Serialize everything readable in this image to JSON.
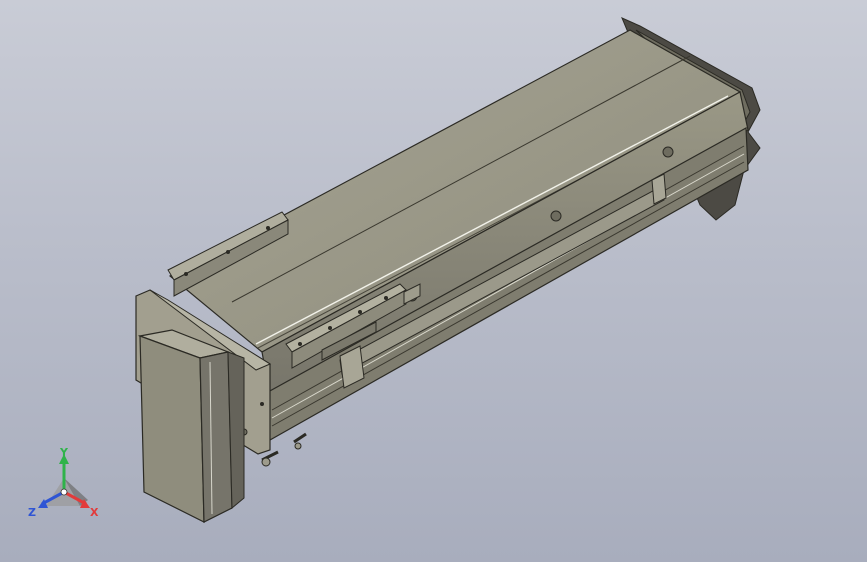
{
  "viewport": {
    "background_top": "#c9ccd6",
    "background_bottom": "#a8adbd"
  },
  "model": {
    "body_color": "#8e8c7a",
    "face_light": "#a3a190",
    "face_dark": "#6f6d5f",
    "edge_color": "#2b2a24"
  },
  "triad": {
    "x_label": "X",
    "y_label": "Y",
    "z_label": "Z",
    "x_color": "#e23b3b",
    "y_color": "#2fb34a",
    "z_color": "#2f55d4"
  }
}
